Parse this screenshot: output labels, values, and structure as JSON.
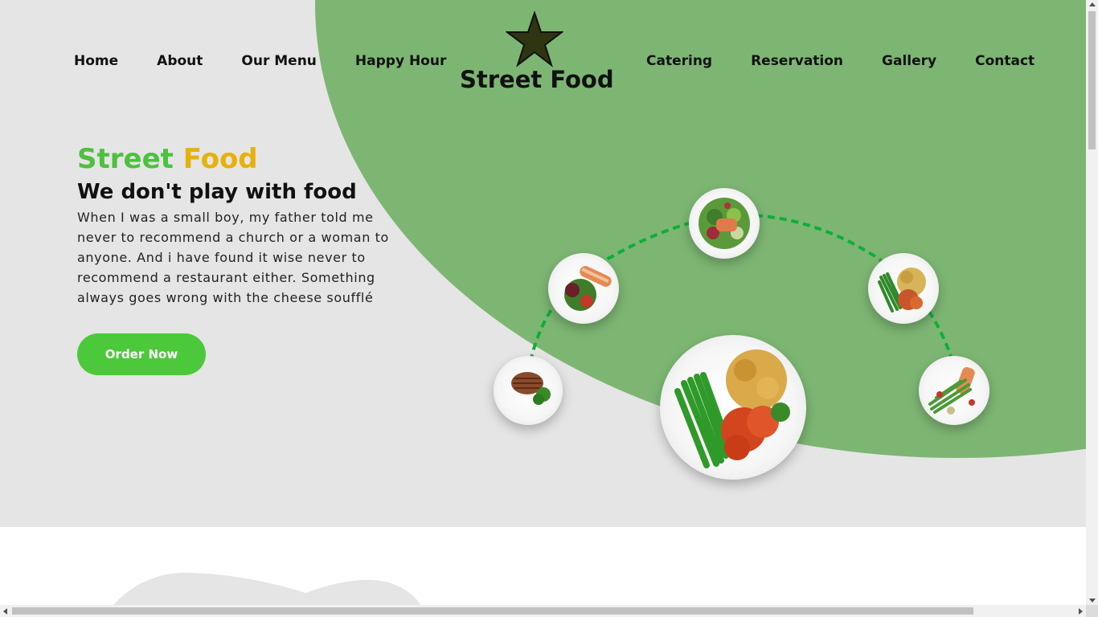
{
  "nav": {
    "left": [
      "Home",
      "About",
      "Our Menu",
      "Happy Hour"
    ],
    "right": [
      "Catering",
      "Reservation",
      "Gallery",
      "Contact"
    ]
  },
  "logo": {
    "text": "Street Food",
    "icon": "star-icon"
  },
  "hero": {
    "title_word1": "Street",
    "title_word2": "Food",
    "subtitle": "We don't play with food",
    "paragraph": "When I was a small boy, my father told me never to recommend a church or a woman to anyone. And i have found it wise never to recommend a restaurant either. Something always goes wrong with the cheese soufflé",
    "button": "Order Now"
  },
  "plates": [
    "salmon-salad-plate",
    "salmon-vegetable-plate",
    "chicken-rice-plate",
    "steak-broccoli-plate",
    "salmon-asparagus-plate",
    "chicken-rice-beans-main-plate"
  ],
  "colors": {
    "accent_green": "#4cc13e",
    "accent_yellow": "#e7b10a",
    "blob_green": "#7db673",
    "background": "#e5e5e5",
    "button_green": "#4cc93a",
    "dashed_arc": "#0fae3c"
  }
}
